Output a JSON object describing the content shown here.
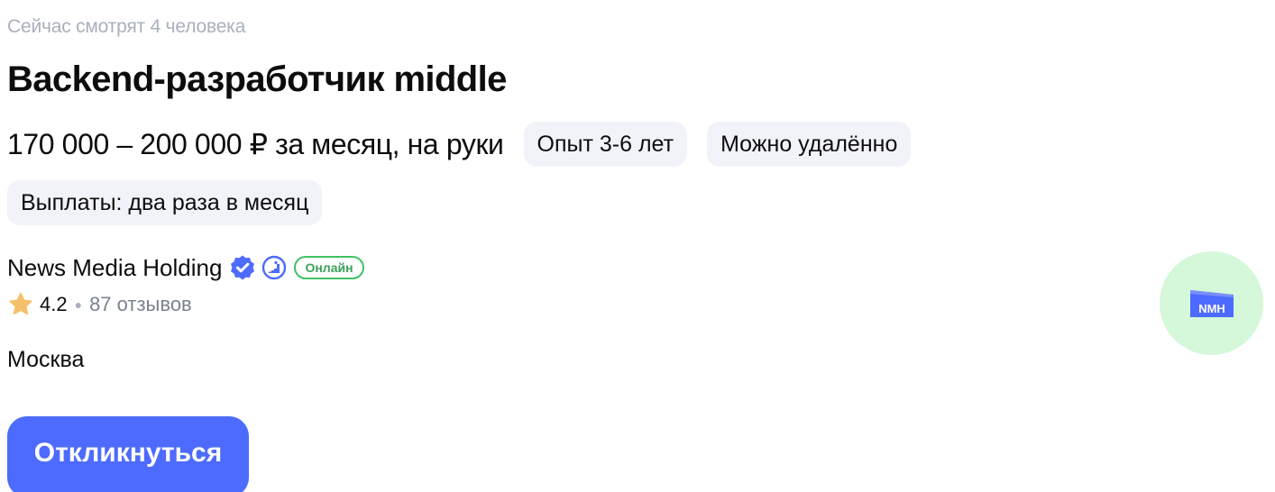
{
  "vacancy": {
    "viewers_text": "Сейчас смотрят 4 человека",
    "title": "Backend-разработчик middle",
    "salary": "170 000 – 200 000 ₽ за месяц, на руки",
    "tags": [
      "Опыт 3-6 лет",
      "Можно удалённо"
    ],
    "payout": "Выплаты: два раза в месяц",
    "city": "Москва",
    "apply_label": "Откликнуться"
  },
  "company": {
    "name": "News Media Holding",
    "verified_icon": "verified-check-icon",
    "employer_icon": "employer-growth-icon",
    "online_label": "Онлайн",
    "rating": "4.2",
    "reviews": "87 отзывов",
    "logo_text": "NMH"
  },
  "colors": {
    "accent": "#4d6bfe",
    "online_green": "#3fc362",
    "star": "#f5c06a",
    "chip_bg": "#f1f3f8",
    "logo_bg": "#d4f8d9"
  }
}
